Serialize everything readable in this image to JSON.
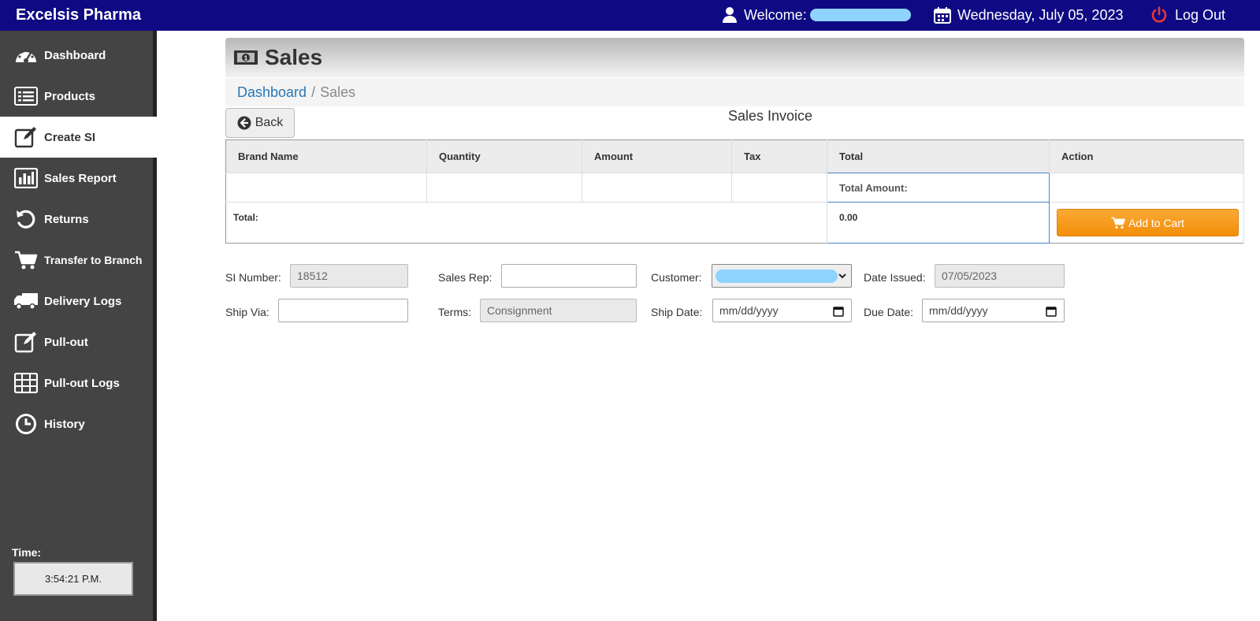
{
  "topbar": {
    "brand": "Excelsis Pharma",
    "welcome_label": "Welcome:",
    "date": "Wednesday, July 05, 2023",
    "logout_label": "Log Out"
  },
  "sidebar": {
    "items": [
      {
        "label": "Dashboard",
        "icon": "dashboard-gauge-icon"
      },
      {
        "label": "Products",
        "icon": "list-icon"
      },
      {
        "label": "Create SI",
        "icon": "edit-icon"
      },
      {
        "label": "Sales Report",
        "icon": "bar-chart-icon"
      },
      {
        "label": "Returns",
        "icon": "undo-icon"
      },
      {
        "label": "Transfer to Branch",
        "icon": "cart-icon"
      },
      {
        "label": "Delivery Logs",
        "icon": "truck-icon"
      },
      {
        "label": "Pull-out",
        "icon": "edit-icon"
      },
      {
        "label": "Pull-out Logs",
        "icon": "grid-icon"
      },
      {
        "label": "History",
        "icon": "clock-icon"
      }
    ],
    "time_label": "Time:",
    "time_value": "3:54:21 P.M."
  },
  "page": {
    "title": "Sales",
    "breadcrumb_link": "Dashboard",
    "breadcrumb_sep": "/",
    "breadcrumb_current": "Sales",
    "back_label": "Back",
    "invoice_title": "Sales Invoice"
  },
  "table": {
    "headers": [
      "Brand Name",
      "Quantity",
      "Amount",
      "Tax",
      "Total",
      "Action"
    ],
    "total_amount_label": "Total Amount:",
    "grand_total_label": "Total:",
    "grand_total_value": "0.00",
    "add_to_cart_label": "Add to Cart"
  },
  "form": {
    "si_number_label": "SI Number:",
    "si_number_value": "18512",
    "sales_rep_label": "Sales Rep:",
    "sales_rep_value": "",
    "customer_label": "Customer:",
    "date_issued_label": "Date Issued:",
    "date_issued_value": "07/05/2023",
    "ship_via_label": "Ship Via:",
    "ship_via_value": "",
    "terms_label": "Terms:",
    "terms_value": "Consignment",
    "ship_date_label": "Ship Date:",
    "ship_date_placeholder": "mm/dd/yyyy",
    "due_date_label": "Due Date:",
    "due_date_placeholder": "mm/dd/yyyy"
  },
  "colors": {
    "topbar": "#0f0a83",
    "sidebar": "#444444",
    "link": "#2677b8",
    "accent_orange": "#f28e08",
    "logout_icon": "#e53935"
  }
}
